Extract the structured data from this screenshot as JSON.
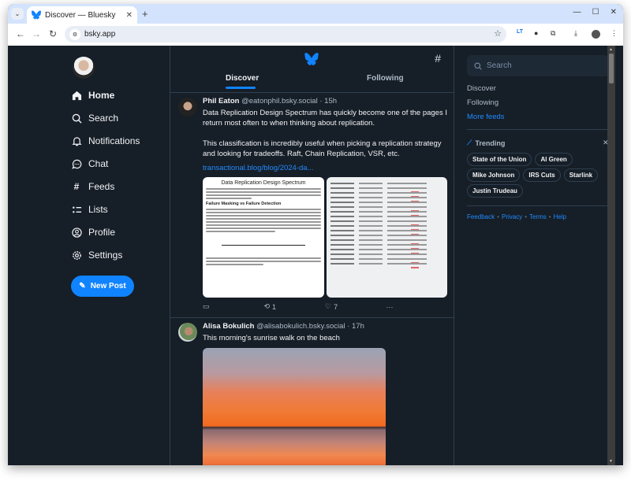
{
  "browser": {
    "tab_title": "Discover — Bluesky",
    "url": "bsky.app",
    "extensions": [
      "LT",
      "privacy-extension",
      "puzzle"
    ]
  },
  "leftnav": {
    "items": [
      {
        "label": "Home",
        "icon": "home-icon",
        "active": true
      },
      {
        "label": "Search",
        "icon": "search-icon"
      },
      {
        "label": "Notifications",
        "icon": "bell-icon"
      },
      {
        "label": "Chat",
        "icon": "chat-icon"
      },
      {
        "label": "Feeds",
        "icon": "hash-icon"
      },
      {
        "label": "Lists",
        "icon": "list-icon"
      },
      {
        "label": "Profile",
        "icon": "profile-icon"
      },
      {
        "label": "Settings",
        "icon": "gear-icon"
      }
    ],
    "new_post_label": "New Post"
  },
  "feed": {
    "tabs": [
      {
        "label": "Discover",
        "active": true
      },
      {
        "label": "Following"
      }
    ],
    "posts": [
      {
        "name": "Phil Eaton",
        "handle": "@eatonphil.bsky.social",
        "time": "15h",
        "text": "Data Replication Design Spectrum has quickly become one of the pages I return most often to when thinking about replication.\n\nThis classification is incredibly useful when picking a replication strategy and looking for tradeoffs. Raft, Chain Replication, VSR, etc.",
        "link": "transactional.blog/blog/2024-da...",
        "image_doc_title": "Data Replication Design Spectrum",
        "image_doc_heading": "Failure Masking vs Failure Detection",
        "replies": "",
        "reposts": "1",
        "likes": "7"
      },
      {
        "name": "Alisa Bokulich",
        "handle": "@alisabokulich.bsky.social",
        "time": "17h",
        "text": "This morning's sunrise walk on the beach"
      }
    ]
  },
  "right": {
    "search_placeholder": "Search",
    "feeds": [
      "Discover",
      "Following"
    ],
    "more_feeds": "More feeds",
    "trending_label": "Trending",
    "trending": [
      "State of the Union",
      "Al Green",
      "Mike Johnson",
      "IRS Cuts",
      "Starlink",
      "Justin Trudeau"
    ],
    "footer": [
      "Feedback",
      "Privacy",
      "Terms",
      "Help"
    ]
  },
  "colors": {
    "accent": "#1083fe",
    "background": "#161e27",
    "border": "#2e4052"
  }
}
